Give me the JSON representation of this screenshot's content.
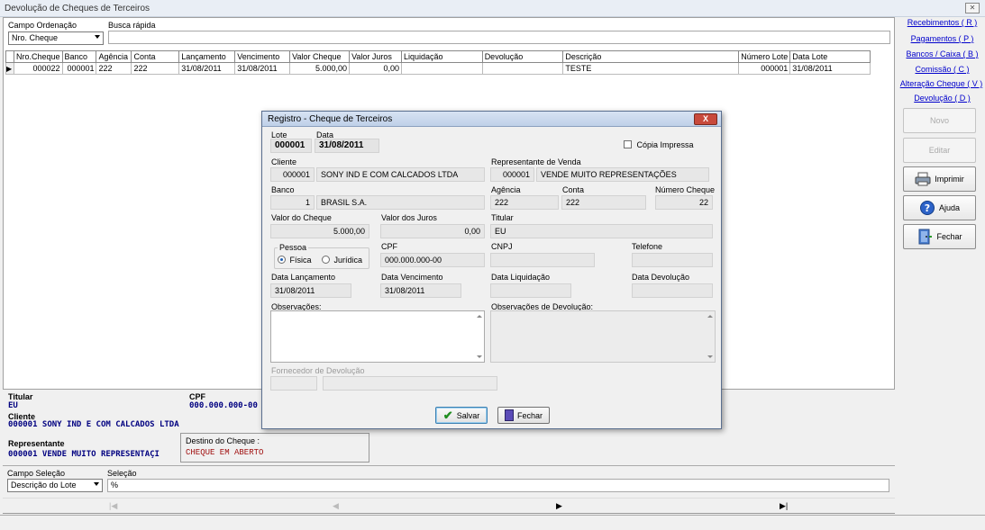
{
  "window": {
    "title": "Devolução de Cheques de Terceiros"
  },
  "filters": {
    "ordenacao_label": "Campo Ordenação",
    "ordenacao_value": "Nro. Cheque",
    "busca_label": "Busca rápida",
    "busca_value": ""
  },
  "table": {
    "columns": [
      "Nro.Cheque",
      "Banco",
      "Agência",
      "Conta",
      "Lançamento",
      "Vencimento",
      "Valor Cheque",
      "Valor Juros",
      "Liquidação",
      "Devolução",
      "Descrição",
      "Número Lote",
      "Data Lote"
    ],
    "rows": [
      [
        "000022",
        "000001",
        "222",
        "222",
        "31/08/2011",
        "31/08/2011",
        "5.000,00",
        "0,00",
        "",
        "",
        "TESTE",
        "000001",
        "31/08/2011"
      ]
    ]
  },
  "sidebar": {
    "links": [
      "Recebimentos ( R )",
      "Pagamentos ( P )",
      "Bancos / Caixa ( B )",
      "Comissão ( C )",
      "Alteração Cheque  ( V )",
      "Devolução ( D )"
    ],
    "buttons": {
      "novo": "Novo",
      "editar": "Editar",
      "imprimir": "Imprimir",
      "ajuda": "Ajuda",
      "fechar": "Fechar"
    }
  },
  "info": {
    "titular_label": "Titular",
    "titular_value": "EU",
    "cpf_label": "CPF",
    "cpf_value": "000.000.000-00",
    "cliente_label": "Cliente",
    "cliente_value": "000001 SONY IND E COM CALCADOS LTDA",
    "representante_label": "Representante",
    "representante_value": "000001 VENDE MUITO REPRESENTAÇI",
    "destino_label": "Destino do Cheque :",
    "destino_value": "CHEQUE EM ABERTO"
  },
  "selecao": {
    "campo_label": "Campo Seleção",
    "campo_value": "Descrição do Lote",
    "selecao_label": "Seleção",
    "selecao_value": "%"
  },
  "nav": {
    "first": "|◀",
    "prev": "◀",
    "next": "▶",
    "last": "▶|"
  },
  "dialog": {
    "title": "Registro - Cheque de Terceiros",
    "close": "X",
    "lote_label": "Lote",
    "lote_value": "000001",
    "data_label": "Data",
    "data_value": "31/08/2011",
    "copia_label": "Cópia Impressa",
    "cliente_label": "Cliente",
    "cliente_code": "000001",
    "cliente_name": "SONY IND E COM CALCADOS LTDA",
    "repr_label": "Representante de Venda",
    "repr_code": "000001",
    "repr_name": "VENDE MUITO REPRESENTAÇÕES",
    "banco_label": "Banco",
    "banco_code": "1",
    "banco_name": "BRASIL S.A.",
    "agencia_label": "Agência",
    "agencia_value": "222",
    "conta_label": "Conta",
    "conta_value": "222",
    "numcheque_label": "Número Cheque",
    "numcheque_value": "22",
    "valor_label": "Valor do Cheque",
    "valor_value": "5.000,00",
    "juros_label": "Valor dos Juros",
    "juros_value": "0,00",
    "titular_label": "Titular",
    "titular_value": "EU",
    "pessoa_label": "Pessoa",
    "fisica_label": "Física",
    "juridica_label": "Jurídica",
    "cpf_label": "CPF",
    "cpf_value": "000.000.000-00",
    "cnpj_label": "CNPJ",
    "cnpj_value": "",
    "telefone_label": "Telefone",
    "telefone_value": "",
    "dtlanc_label": "Data Lançamento",
    "dtlanc_value": "31/08/2011",
    "dtvenc_label": "Data Vencimento",
    "dtvenc_value": "31/08/2011",
    "dtliq_label": "Data Liquidação",
    "dtliq_value": "",
    "dtdev_label": "Data Devolução",
    "dtdev_value": "",
    "obs_label": "Observações:",
    "obsdev_label": "Observações de Devolução:",
    "fornecedor_label": "Fornecedor de Devolução",
    "salvar": "Salvar",
    "fechar": "Fechar"
  }
}
